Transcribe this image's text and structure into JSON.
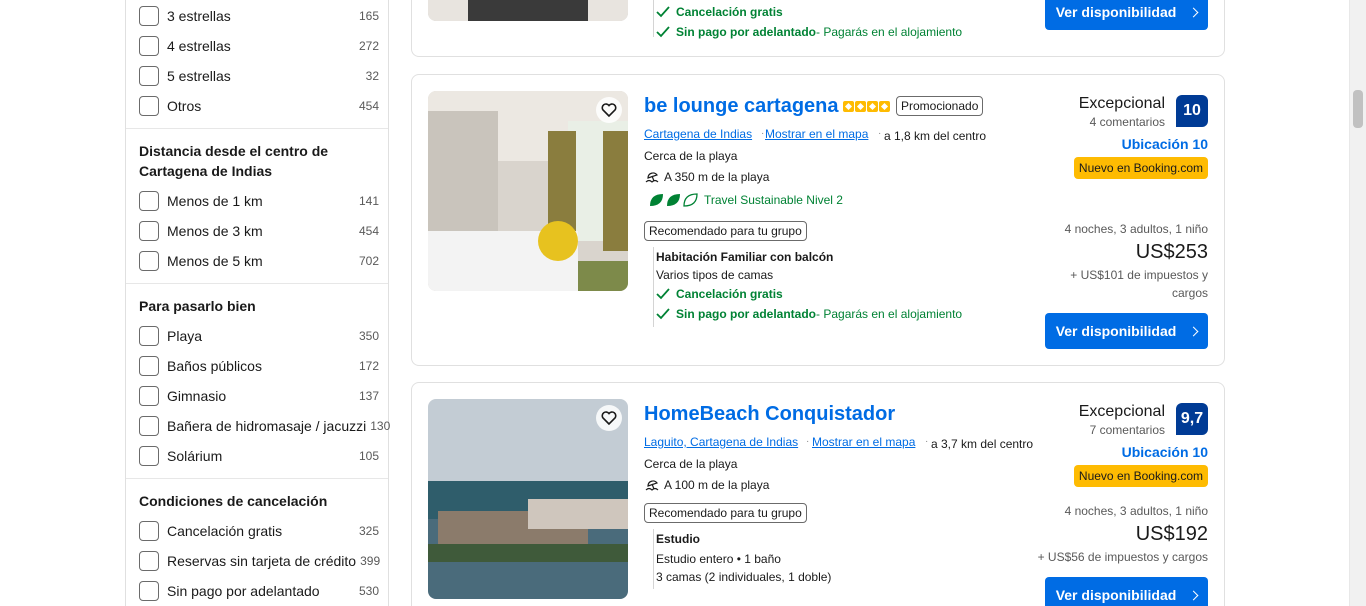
{
  "filters": {
    "stars": [
      {
        "label": "3 estrellas",
        "count": "165"
      },
      {
        "label": "4 estrellas",
        "count": "272"
      },
      {
        "label": "5 estrellas",
        "count": "32"
      },
      {
        "label": "Otros",
        "count": "454"
      }
    ],
    "distance": {
      "title": "Distancia desde el centro de Cartagena de Indias",
      "items": [
        {
          "label": "Menos de 1 km",
          "count": "141"
        },
        {
          "label": "Menos de 3 km",
          "count": "454"
        },
        {
          "label": "Menos de 5 km",
          "count": "702"
        }
      ]
    },
    "fun": {
      "title": "Para pasarlo bien",
      "items": [
        {
          "label": "Playa",
          "count": "350"
        },
        {
          "label": "Baños públicos",
          "count": "172"
        },
        {
          "label": "Gimnasio",
          "count": "137"
        },
        {
          "label": "Bañera de hidromasaje / jacuzzi",
          "count": "130"
        },
        {
          "label": "Solárium",
          "count": "105"
        }
      ]
    },
    "cancellation": {
      "title": "Condiciones de cancelación",
      "items": [
        {
          "label": "Cancelación gratis",
          "count": "325"
        },
        {
          "label": "Reservas sin tarjeta de crédito",
          "count": "399"
        },
        {
          "label": "Sin pago por adelantado",
          "count": "530"
        }
      ]
    }
  },
  "card0": {
    "perk1": "Cancelación gratis",
    "perk2": "Sin pago por adelantado",
    "perk2_note": " - Pagarás en el alojamiento",
    "button": "Ver disponibilidad"
  },
  "card1": {
    "name": "be lounge cartagena",
    "promo": "Promocionado",
    "city": "Cartagena de Indias",
    "map": "Mostrar en el mapa",
    "distance": "a 1,8 km del centro",
    "near": "Cerca de la playa",
    "beach": "A 350 m de la playa",
    "sustainable": "Travel Sustainable Nivel 2",
    "group": "Recomendado para tu grupo",
    "room": "Habitación Familiar con balcón",
    "beds": "Varios tipos de camas",
    "perk1": "Cancelación gratis",
    "perk2": "Sin pago por adelantado",
    "perk2_note": " - Pagarás en el alojamiento",
    "review_word": "Excepcional",
    "review_count": "4 comentarios",
    "score": "10",
    "location_score": "Ubicación 10",
    "new_badge": "Nuevo en Booking.com",
    "stay": "4 noches, 3 adultos, 1 niño",
    "price": "US$253",
    "taxes": "+ US$101 de impuestos y cargos",
    "button": "Ver disponibilidad"
  },
  "card2": {
    "name": "HomeBeach Conquistador",
    "city": "Laguito, Cartagena de Indias",
    "map": "Mostrar en el mapa",
    "distance": "a 3,7 km del centro",
    "near": "Cerca de la playa",
    "beach": "A 100 m de la playa",
    "group": "Recomendado para tu grupo",
    "room": "Estudio",
    "room_detail": "Estudio entero • 1 baño",
    "beds": "3 camas (2 individuales, 1 doble)",
    "review_word": "Excepcional",
    "review_count": "7 comentarios",
    "score": "9,7",
    "location_score": "Ubicación 10",
    "new_badge": "Nuevo en Booking.com",
    "stay": "4 noches, 3 adultos, 1 niño",
    "price": "US$192",
    "taxes": "+ US$56 de impuestos y cargos",
    "button": "Ver disponibilidad"
  },
  "colors": {
    "brand_blue": "#006ce4",
    "score_blue": "#003b95",
    "green": "#008234",
    "yellow": "#febb02"
  }
}
